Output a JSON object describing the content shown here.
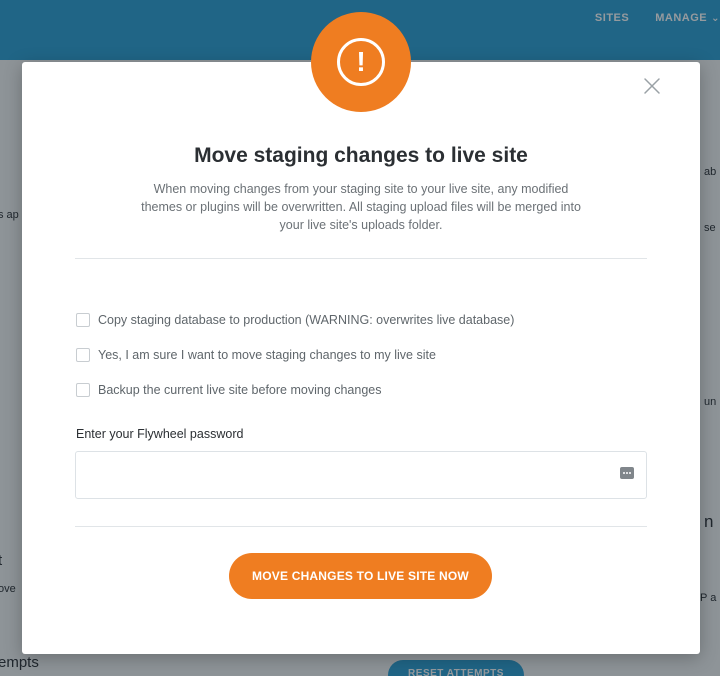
{
  "background": {
    "nav": {
      "sites": "SITES",
      "manage": "MANAGE"
    },
    "fragments": {
      "left_1": "s ap",
      "left_2": "t",
      "left_3": "ove",
      "left_4": "empts",
      "right_1": "ab",
      "right_2": "se",
      "right_3": "un",
      "right_4": "n",
      "right_5": "P a"
    },
    "button_label": "RESET ATTEMPTS"
  },
  "modal": {
    "alert_icon": "exclamation-icon",
    "alert_glyph": "!",
    "close_icon": "close-icon",
    "title": "Move staging changes to live site",
    "description": "When moving changes from your staging site to your live site, any modified themes or plugins will be overwritten. All staging upload files will be merged into your live site's uploads folder.",
    "options": [
      {
        "label": "Copy staging database to production  (WARNING: overwrites live database)",
        "checked": false
      },
      {
        "label": "Yes, I am sure I want to move staging changes to my live site",
        "checked": false
      },
      {
        "label": "Backup the current live site before moving changes",
        "checked": false
      }
    ],
    "password": {
      "label": "Enter your Flywheel password",
      "value": "",
      "placeholder": "",
      "icon": "password-key-icon"
    },
    "submit_label": "MOVE CHANGES TO LIVE SITE NOW"
  },
  "colors": {
    "accent_orange": "#ef7d21",
    "brand_blue": "#2a9fd4",
    "title_text": "#2b2f33",
    "muted_text": "#6b7176"
  }
}
